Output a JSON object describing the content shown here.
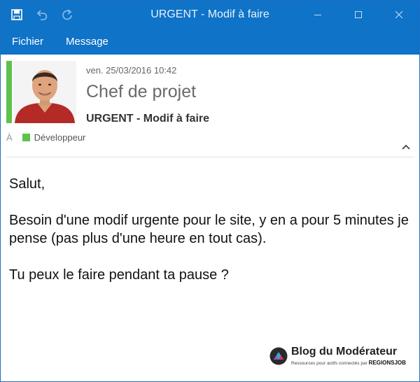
{
  "window": {
    "title": "URGENT - Modif à faire"
  },
  "quick_access": [
    "save-icon",
    "undo-icon",
    "redo-icon"
  ],
  "window_controls": [
    "minimize-icon",
    "maximize-icon",
    "close-icon"
  ],
  "menu": {
    "items": [
      "Fichier",
      "Message"
    ]
  },
  "message": {
    "date": "ven. 25/03/2016  10:42",
    "sender": "Chef de projet",
    "subject": "URGENT - Modif à faire",
    "to_label": "À",
    "recipient": "Développeur",
    "body": [
      "Salut,",
      "Besoin d'une modif urgente pour le site, y en a pour 5 minutes je pense (pas plus d'une heure en tout cas).",
      "Tu peux le faire pendant ta pause ?"
    ]
  },
  "watermark": {
    "title": "Blog du Modérateur",
    "tagline": "Ressources pour actifs connectés par",
    "brand": "REGIONSJOB"
  },
  "colors": {
    "accent": "#0f73c8",
    "category": "#5cc24a"
  }
}
